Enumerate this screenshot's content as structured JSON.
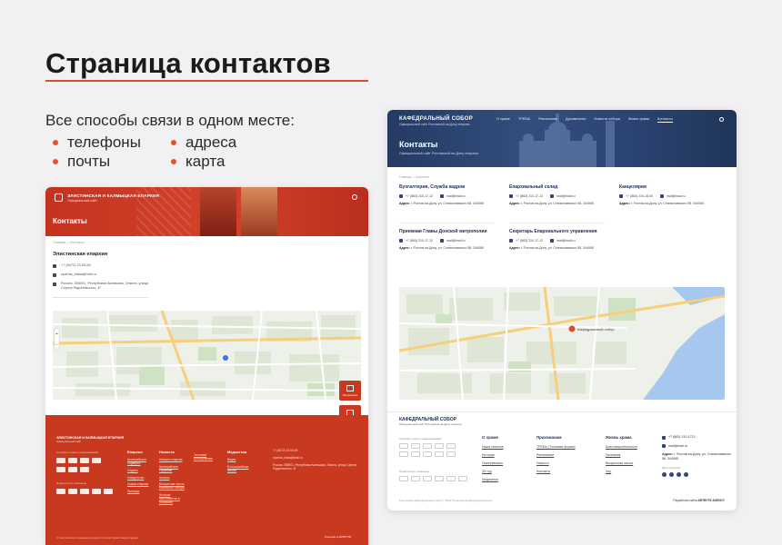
{
  "page": {
    "title": "Страница контактов",
    "subtitle": "Все способы связи в одном месте:",
    "bullets": [
      "телефоны",
      "адреса",
      "почты",
      "карта"
    ],
    "colors": {
      "accent": "#d84b2c",
      "left_brand": "#c9391f",
      "right_brand": "#243a63"
    }
  },
  "left_site": {
    "brand": "ЭЛИСТИНСКАЯ И КАЛМЫЦКАЯ ЕПАРХИЯ",
    "brand_sub": "Официальный сайт",
    "page_title": "Контакты",
    "breadcrumb": "Главная  —  Контакты",
    "org": "Элистинская епархия",
    "phone": "+7 (8472) 23-05-69",
    "email": "eparhia_elista@mail.ru",
    "address": "Россия, 358001, Республика Калмыкия, Элиста, улица Сергия Радонежского, 4Г",
    "side_buttons": [
      "Расписание",
      "Звонить"
    ],
    "footer": {
      "brand": "ЭЛИСТИНСКАЯ И КАЛМЫЦКАЯ ЕПАРХИЯ",
      "brand_sub": "Официальный сайт",
      "pay_label": "Способы оплаты пожертвований",
      "share_label": "Поделиться с помощью",
      "cols": [
        {
          "head": "Епархия",
          "links": [
            "Архиерейское Подворье",
            "Отделы",
            "Священство",
            "Храмы епархии",
            "Приходы"
          ]
        },
        {
          "head": "Новости",
          "links": [
            "Новости епархии",
            "Архиерейское служение",
            "Анонсы",
            "Воскресная школа Казанского собора",
            "История христианства в Калмыкии"
          ]
        },
        {
          "head": "",
          "links": [
            "Тестовый Богослужение"
          ]
        },
        {
          "head": "Медиатека",
          "links": [
            "Видео",
            "Богослужебные записи"
          ]
        }
      ],
      "contacts": [
        "+7 (8472) 23-05-69",
        "eparhia_elista@mail.ru",
        "Россия, 358001, Республика Калмыкия, Элиста, улица Сергия Радонежского, 4Г"
      ],
      "dev": "Сделано в ARTBYTE",
      "bottom": "© Элистинская и Калмыцкая епархия Русской Православной Церкви"
    }
  },
  "right_site": {
    "brand": "КАФЕДРАЛЬНЫЙ СОБОР",
    "brand_sub": "Официальный сайт Ростовской-на-Дону епархии",
    "nav": [
      "О храме",
      "ТРЕБЫ",
      "Расписание",
      "Духовенство",
      "Новости собора",
      "Жизнь храма",
      "Контакты"
    ],
    "page_title": "Контакты",
    "page_subtitle": "Официальный сайт Ростовской-на-Дону епархии",
    "breadcrumb": "Главная  —  Контакты",
    "blocks": [
      {
        "title": "Бухгалтерия, Служба кадров",
        "phone": "+7 (863) 210-17-12",
        "email": "mail@mail.ru",
        "addr_label": "Адрес:",
        "addr": "г. Ростов-на-Дону, ул. Станиславского 58, 344065"
      },
      {
        "title": "Епархиальный склад",
        "phone": "+7 (863) 210-17-12",
        "email": "mail@mail.ru",
        "addr_label": "Адрес:",
        "addr": "г. Ростов-на-Дону, ул. Станиславского 58, 344065"
      },
      {
        "title": "Канцелярия",
        "phone": "+7 (863) 210-18-00",
        "email": "mail@mail.ru",
        "addr_label": "Адрес:",
        "addr": "г. Ростов-на-Дону, ул. Станиславского 58, 344065"
      },
      {
        "title": "Приемная Главы Донской митрополии",
        "phone": "+7 (863) 210-17-12",
        "email": "mail@mail.ru",
        "addr_label": "Адрес:",
        "addr": "г. Ростов-на-Дону, ул. Станиславского 58, 344065"
      },
      {
        "title": "Секретарь Епархиального управления",
        "phone": "+7 (863) 210-17-12",
        "email": "mail@mail.ru",
        "addr_label": "Адрес:",
        "addr": "г. Ростов-на-Дону, ул. Станиславского 58, 344065"
      }
    ],
    "footer": {
      "brand": "КАФЕДРАЛЬНЫЙ СОБОР",
      "brand_sub": "Официальный сайт Ростовской-на-Дону епархии",
      "pay_label": "Способы оплаты пожертвований",
      "share_label": "Поделиться с помощью",
      "cols": [
        {
          "head": "О храме",
          "links": [
            "Наша святыня",
            "История",
            "Пожертвовать",
            "3D тур",
            "Медиатека"
          ]
        },
        {
          "head": "Прихожанам",
          "links": [
            "ТРЕБЫ (Толковая форма)",
            "Расписание",
            "Новости",
            "Контакты"
          ]
        },
        {
          "head": "Жизнь храма",
          "links": [
            "Благотворительность",
            "Паломник",
            "Воскресная школа",
            "Хор"
          ]
        }
      ],
      "phone": "+7 (863) 210-1712",
      "email": "mail@mail.ru",
      "addr_label": "Адрес:",
      "addr": "г. Ростов-на-Дону, ул. Станиславского 58, 344065",
      "social_label": "Мы в соцсетях",
      "bottom": "Ростовский кафедральный собор © 2022    Политика конфиденциальности",
      "dev_prefix": "Разработка сайта",
      "dev_name": "ARTBYTE AGENCY"
    }
  }
}
